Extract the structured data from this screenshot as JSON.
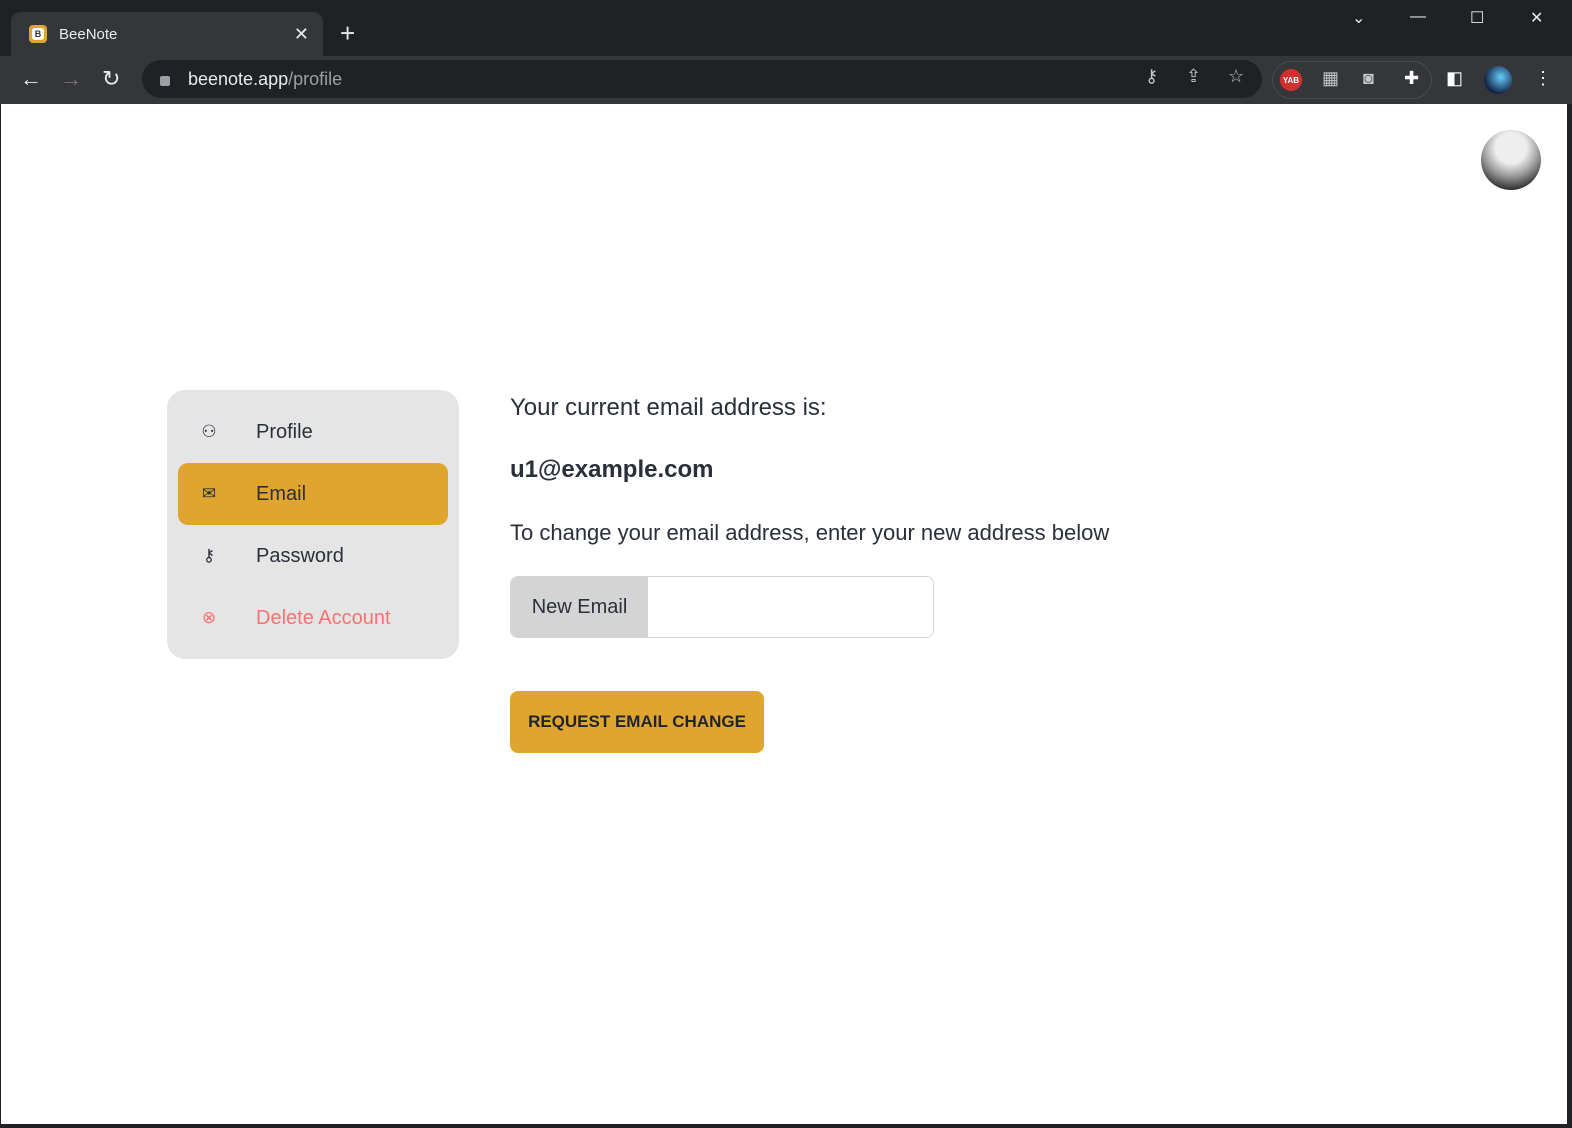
{
  "browser": {
    "tab_title": "BeeNote",
    "favicon_letter": "B",
    "url_host": "beenote.app",
    "url_path": "/profile",
    "extensions": {
      "yab_label": "YAB"
    }
  },
  "colors": {
    "accent": "#e0a52e",
    "danger": "#f87272",
    "menu_bg": "#e5e5e5"
  },
  "sidebar": {
    "items": [
      {
        "label": "Profile",
        "icon": "user-icon"
      },
      {
        "label": "Email",
        "icon": "mail-icon",
        "active": true
      },
      {
        "label": "Password",
        "icon": "key-icon"
      },
      {
        "label": "Delete Account",
        "icon": "circle-x-icon",
        "danger": true
      }
    ]
  },
  "main": {
    "current_label": "Your current email address is:",
    "current_email": "u1@example.com",
    "instruction": "To change your email address, enter your new address below",
    "new_email_label": "New Email",
    "new_email_value": "",
    "submit_label": "REQUEST EMAIL CHANGE"
  }
}
